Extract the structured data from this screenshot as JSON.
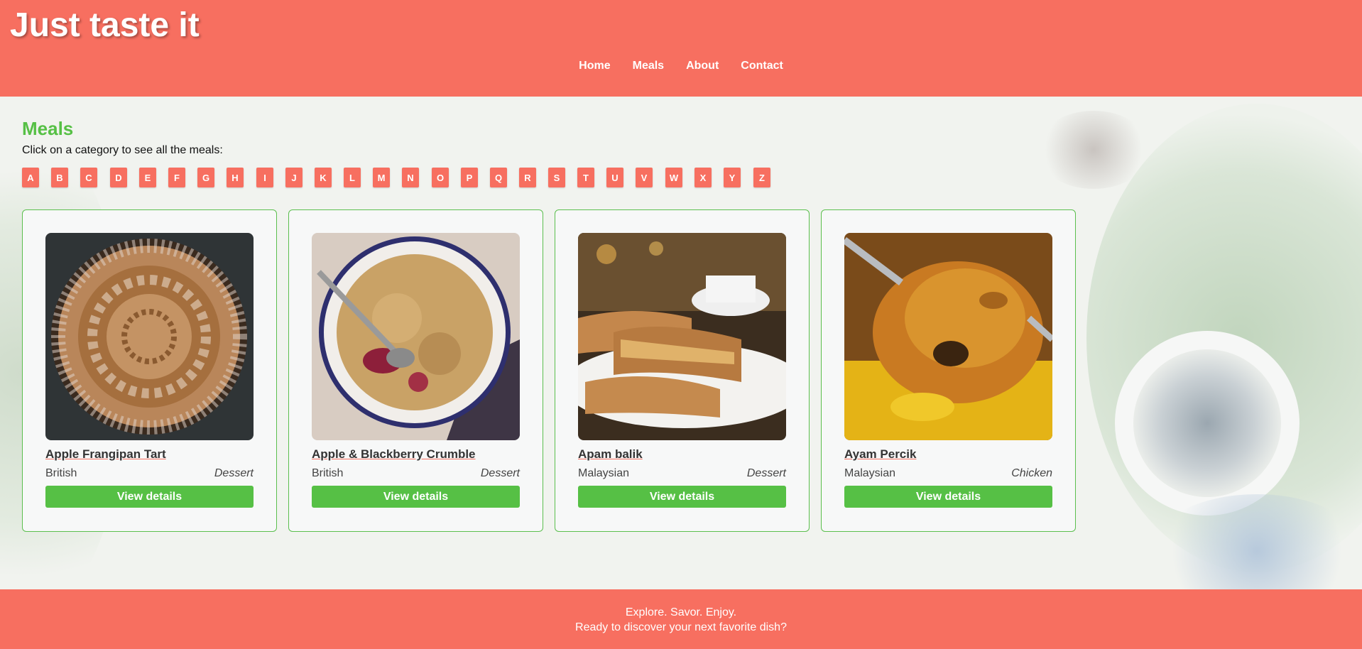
{
  "header": {
    "site_title": "Just taste it",
    "nav": [
      "Home",
      "Meals",
      "About",
      "Contact"
    ]
  },
  "main": {
    "title": "Meals",
    "subtitle": "Click on a category to see all the meals:",
    "letters": [
      "A",
      "B",
      "C",
      "D",
      "E",
      "F",
      "G",
      "H",
      "I",
      "J",
      "K",
      "L",
      "M",
      "N",
      "O",
      "P",
      "Q",
      "R",
      "S",
      "T",
      "U",
      "V",
      "W",
      "X",
      "Y",
      "Z"
    ]
  },
  "meals": [
    {
      "name": "Apple Frangipan Tart",
      "area": "British",
      "category": "Dessert",
      "button": "View details",
      "image": "apple-tart-photo"
    },
    {
      "name": "Apple & Blackberry Crumble",
      "area": "British",
      "category": "Dessert",
      "button": "View details",
      "image": "crumble-photo"
    },
    {
      "name": "Apam balik",
      "area": "Malaysian",
      "category": "Dessert",
      "button": "View details",
      "image": "apam-balik-photo"
    },
    {
      "name": "Ayam Percik",
      "area": "Malaysian",
      "category": "Chicken",
      "button": "View details",
      "image": "ayam-percik-photo"
    }
  ],
  "footer": {
    "line1": "Explore. Savor. Enjoy.",
    "line2": "Ready to discover your next favorite dish?"
  },
  "colors": {
    "brand": "#f76f60",
    "accent": "#56c045"
  }
}
